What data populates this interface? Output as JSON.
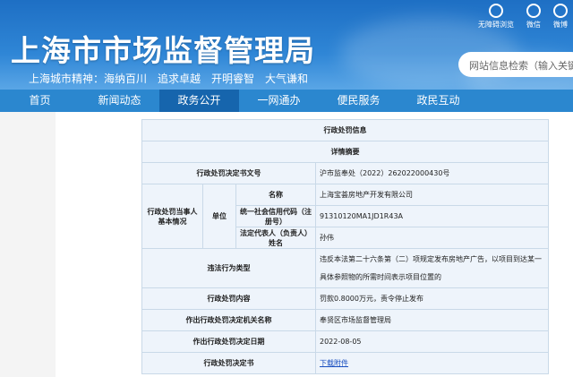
{
  "header": {
    "title": "上海市市场监督管理局",
    "motto": [
      "上海城市精神：海纳百川",
      "追求卓越",
      "开明睿智",
      "大气谦和"
    ],
    "icons": [
      {
        "name": "eye-icon",
        "label": "无障碍浏览"
      },
      {
        "name": "wechat-icon",
        "label": "微信"
      },
      {
        "name": "weibo-icon",
        "label": "微博"
      }
    ],
    "search_placeholder": "网站信息检索（输入关键字"
  },
  "nav": [
    "首页",
    "新闻动态",
    "政务公开",
    "一网通办",
    "便民服务",
    "政民互动"
  ],
  "nav_active": "政务公开",
  "table": {
    "title": "行政处罚信息",
    "subtitle": "详情摘要",
    "doc_no_label": "行政处罚决定书文号",
    "doc_no": "沪市监奉处（2022）262022000430号",
    "party_label": "行政处罚当事人基本情况",
    "unit_label": "单位",
    "name_label": "名称",
    "name": "上海宝荟房地产开发有限公司",
    "code_label": "统一社会信用代码（注册号）",
    "code": "91310120MA1JD1R43A",
    "rep_label": "法定代表人（负责人）姓名",
    "rep": "孙伟",
    "violation_label": "违法行为类型",
    "violation": "违反本法第二十六条第（二）项规定发布房地产广告，以项目到达某一具体参照物的所需时间表示项目位置的",
    "content_label": "行政处罚内容",
    "content": "罚款0.8000万元，责令停止发布",
    "org_label": "作出行政处罚决定机关名称",
    "org": "奉贤区市场监督管理局",
    "date_label": "作出行政处罚决定日期",
    "date": "2022-08-05",
    "file_label": "行政处罚决定书",
    "file_link": "下载附件"
  }
}
